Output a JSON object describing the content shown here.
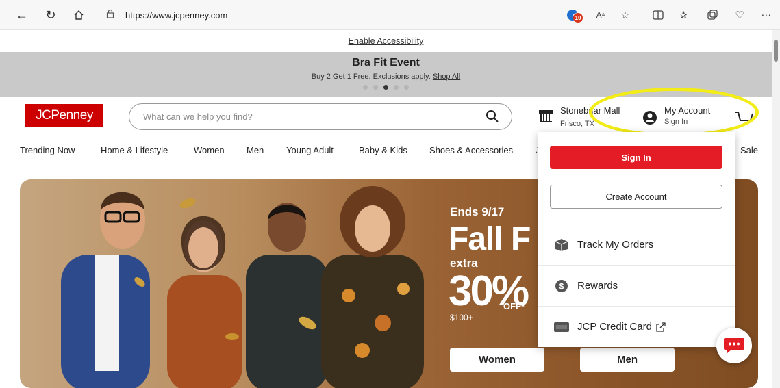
{
  "browser": {
    "url": "https://www.jcpenney.com",
    "extension_badge": "10"
  },
  "accessibility_link": "Enable Accessibility",
  "promo": {
    "title": "Bra Fit Event",
    "subtitle": "Buy 2 Get 1 Free. Exclusions apply.",
    "link": "Shop All"
  },
  "header": {
    "logo": "JCPenney",
    "search_placeholder": "What can we help you find?",
    "store_name": "Stonebriar Mall",
    "store_city": "Frisco, TX",
    "account_title": "My Account",
    "account_sub": "Sign In"
  },
  "categories": [
    "Trending Now",
    "Home & Lifestyle",
    "Women",
    "Men",
    "Young Adult",
    "Baby & Kids",
    "Shoes & Accessories",
    "J",
    "Sale"
  ],
  "hero": {
    "ends": "Ends 9/17",
    "headline": "Fall F",
    "extra": "extra",
    "percent": "30%",
    "off": "OFF*",
    "minimum": "$100+",
    "btn_women": "Women",
    "btn_men": "Men"
  },
  "account_menu": {
    "signin": "Sign In",
    "create": "Create Account",
    "items": [
      {
        "label": "Track My Orders",
        "icon": "package-icon"
      },
      {
        "label": "Rewards",
        "icon": "dollar-icon"
      },
      {
        "label": "JCP Credit Card",
        "icon": "card-icon"
      }
    ]
  },
  "colors": {
    "brand": "#cc0000",
    "highlight": "#f3ec16",
    "signin": "#e31c25"
  }
}
